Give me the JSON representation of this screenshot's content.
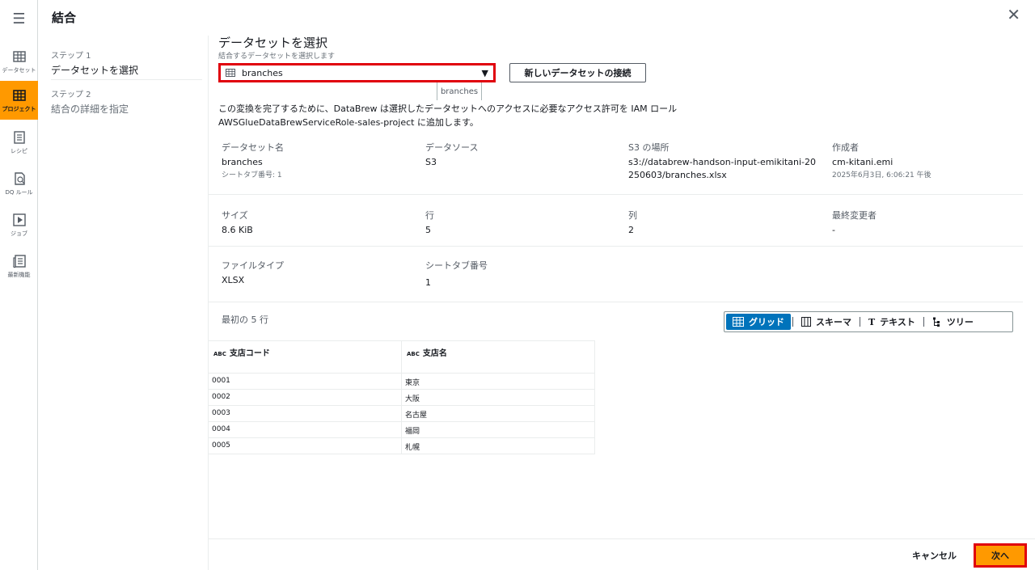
{
  "nav": {
    "items": [
      {
        "label": "データセット",
        "icon": "table-icon"
      },
      {
        "label": "プロジェクト",
        "icon": "project-grid-icon"
      },
      {
        "label": "レシピ",
        "icon": "recipe-list-icon"
      },
      {
        "label": "DQ ルール",
        "icon": "dq-rule-icon"
      },
      {
        "label": "ジョブ",
        "icon": "job-play-icon"
      },
      {
        "label": "最新機能",
        "icon": "news-icon"
      }
    ]
  },
  "header": {
    "title": "結合"
  },
  "steps": [
    {
      "num": "ステップ 1",
      "label": "データセットを選択"
    },
    {
      "num": "ステップ 2",
      "label": "結合の詳細を指定"
    }
  ],
  "main": {
    "section_title": "データセットを選択",
    "section_desc": "結合するデータセットを選択します",
    "selected_dataset": "branches",
    "tooltip": "branches",
    "new_dataset_button": "新しいデータセットの接続",
    "permission_text_1": "この変換を完了するために、DataBrew は選択したデータセットへのアクセスに必要なアクセス許可を IAM ロール",
    "permission_text_2": "AWSGlueDataBrewServiceRole-sales-project に追加します。"
  },
  "details": {
    "dataset_name_label": "データセット名",
    "dataset_name": "branches",
    "sheet_tab_sub": "シートタブ番号: 1",
    "source_label": "データソース",
    "source": "S3",
    "s3_label": "S3 の場所",
    "s3_line1": "s3://databrew-handson-input-emikitani-20",
    "s3_line2": "250603/branches.xlsx",
    "creator_label": "作成者",
    "creator": "cm-kitani.emi",
    "created_at": "2025年6月3日, 6:06:21 午後",
    "size_label": "サイズ",
    "size": "8.6 KiB",
    "rows_label": "行",
    "rows": "5",
    "cols_label": "列",
    "cols": "2",
    "modifier_label": "最終変更者",
    "modifier": "-",
    "filetype_label": "ファイルタイプ",
    "filetype": "XLSX",
    "sheettab_label": "シートタブ番号",
    "sheettab": "1"
  },
  "preview": {
    "title": "最初の 5 行",
    "views": [
      "グリッド",
      "スキーマ",
      "テキスト",
      "ツリー"
    ],
    "type_badge": "ABC",
    "columns": [
      "支店コード",
      "支店名"
    ],
    "rows": [
      [
        "0001",
        "東京"
      ],
      [
        "0002",
        "大阪"
      ],
      [
        "0003",
        "名古屋"
      ],
      [
        "0004",
        "福岡"
      ],
      [
        "0005",
        "札幌"
      ]
    ]
  },
  "footer": {
    "cancel": "キャンセル",
    "next": "次へ"
  },
  "colors": {
    "accent": "#ff9900",
    "highlight": "#e0000d",
    "selected": "#0073bb"
  }
}
